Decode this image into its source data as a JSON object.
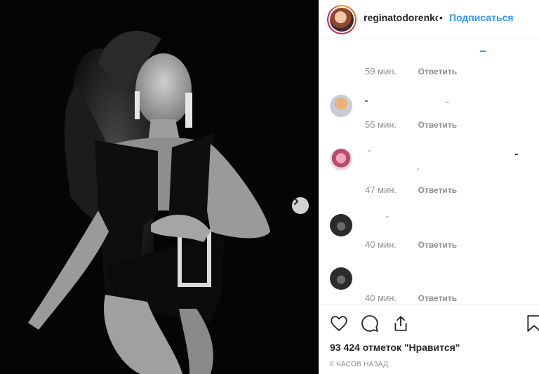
{
  "header": {
    "username": "reginatodorenko",
    "separator": "•",
    "follow_label": "Подписаться"
  },
  "comments": [
    {
      "time": "59 мин.",
      "reply": "Ответить"
    },
    {
      "time": "55 мин.",
      "reply": "Ответить"
    },
    {
      "time": "47 мин.",
      "reply": "Ответить"
    },
    {
      "time": "40 мин.",
      "reply": "Ответить"
    },
    {
      "time": "40 мин.",
      "reply": "Ответить"
    }
  ],
  "footer": {
    "likes": "93 424 отметок \"Нравится\"",
    "posted": "6 часов назад"
  },
  "icons": {
    "like": "heart-icon",
    "comment": "comment-icon",
    "share": "share-icon",
    "save": "bookmark-icon",
    "next": "chevron-right-icon"
  },
  "colors": {
    "accent": "#3897f0",
    "muted": "#8e8e8e",
    "text": "#262626"
  }
}
